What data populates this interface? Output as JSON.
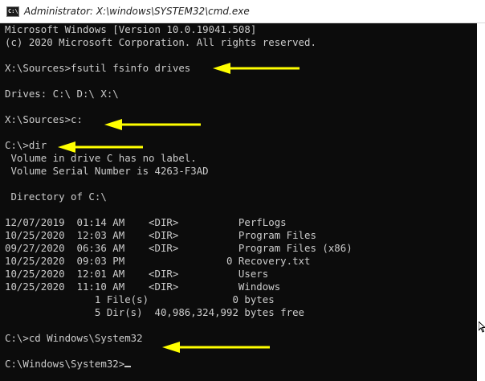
{
  "window": {
    "title": "Administrator: X:\\windows\\SYSTEM32\\cmd.exe",
    "icon_label": "C:\\",
    "icon_name": "cmd-icon"
  },
  "console": {
    "background": "#0c0c0c",
    "foreground": "#cccccc",
    "arrow_color": "#ffff00",
    "lines": [
      "Microsoft Windows [Version 10.0.19041.508]",
      "(c) 2020 Microsoft Corporation. All rights reserved.",
      "",
      "X:\\Sources>fsutil fsinfo drives",
      "",
      "Drives: C:\\ D:\\ X:\\",
      "",
      "X:\\Sources>c:",
      "",
      "C:\\>dir",
      " Volume in drive C has no label.",
      " Volume Serial Number is 4263-F3AD",
      "",
      " Directory of C:\\",
      "",
      "12/07/2019  01:14 AM    <DIR>          PerfLogs",
      "10/25/2020  12:03 AM    <DIR>          Program Files",
      "09/27/2020  06:36 AM    <DIR>          Program Files (x86)",
      "10/25/2020  09:03 PM                 0 Recovery.txt",
      "10/25/2020  12:01 AM    <DIR>          Users",
      "10/25/2020  11:10 AM    <DIR>          Windows",
      "               1 File(s)              0 bytes",
      "               5 Dir(s)  40,986,324,992 bytes free",
      "",
      "C:\\>cd Windows\\System32",
      "",
      "C:\\Windows\\System32>"
    ]
  }
}
